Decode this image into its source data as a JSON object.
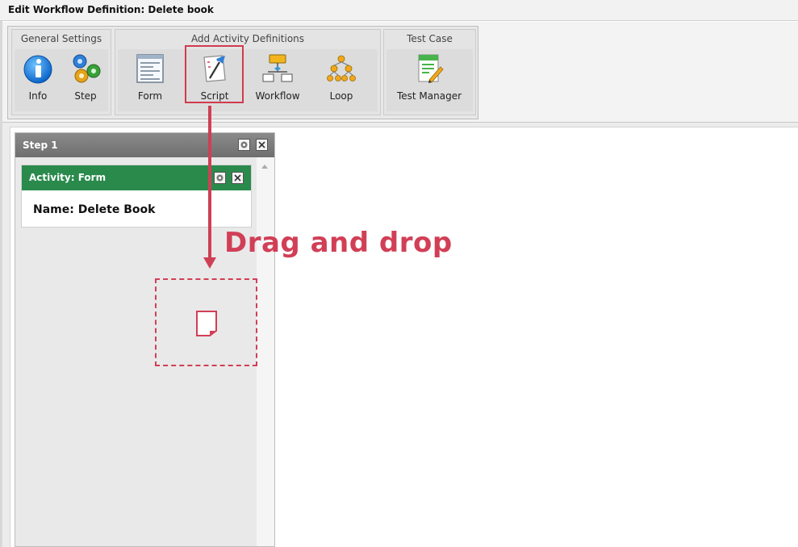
{
  "window": {
    "title": "Edit Workflow Definition: Delete book"
  },
  "toolbar": {
    "groups": [
      {
        "title": "General Settings",
        "items": [
          {
            "label": "Info",
            "icon": "info-icon"
          },
          {
            "label": "Step",
            "icon": "gears-icon"
          }
        ]
      },
      {
        "title": "Add Activity Definitions",
        "items": [
          {
            "label": "Form",
            "icon": "form-icon"
          },
          {
            "label": "Script",
            "icon": "script-icon"
          },
          {
            "label": "Workflow",
            "icon": "workflow-icon"
          },
          {
            "label": "Loop",
            "icon": "loop-icon"
          }
        ]
      },
      {
        "title": "Test Case",
        "items": [
          {
            "label": "Test Manager",
            "icon": "test-manager-icon"
          }
        ]
      }
    ]
  },
  "step": {
    "title": "Step 1",
    "activity": {
      "header": "Activity: Form",
      "name": "Name: Delete Book"
    }
  },
  "annotation": {
    "text": "Drag and drop",
    "color": "#d13f56"
  },
  "colors": {
    "activity_header": "#2a8a4c",
    "step_header": "#7d7d7d",
    "highlight": "#d03c4e"
  }
}
